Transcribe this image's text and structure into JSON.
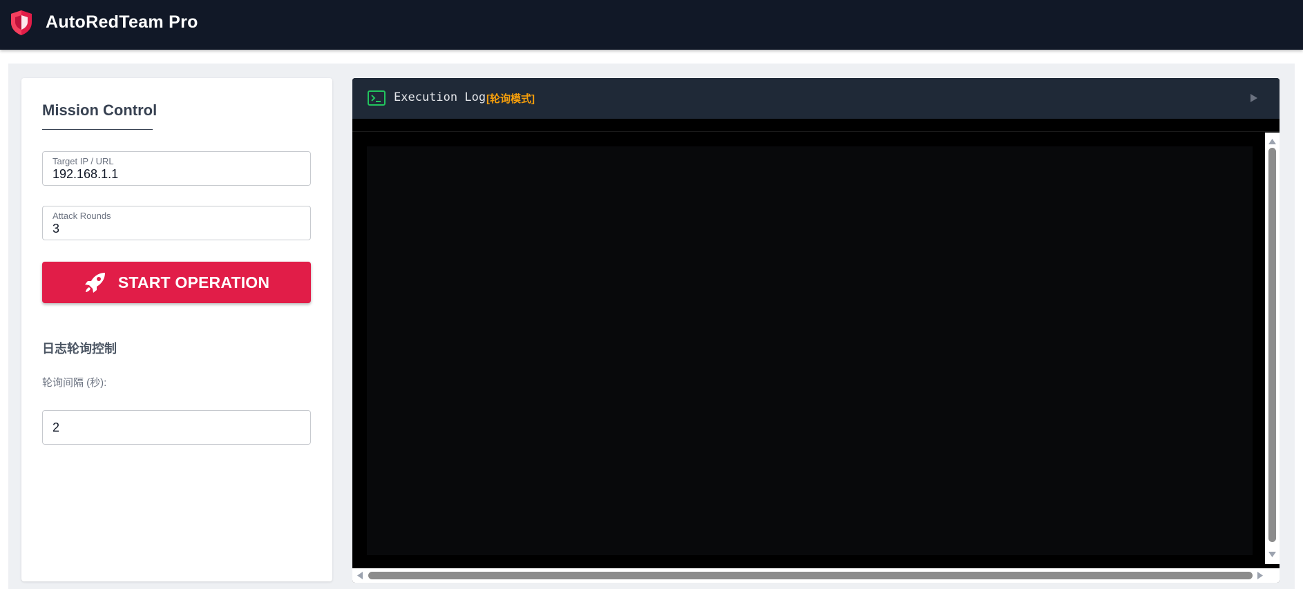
{
  "app": {
    "title": "AutoRedTeam Pro",
    "logo_icon": "shield-icon",
    "accent_color": "#e11d48"
  },
  "mission_control": {
    "title": "Mission Control",
    "target": {
      "label": "Target IP / URL",
      "value": "192.168.1.1"
    },
    "rounds": {
      "label": "Attack Rounds",
      "value": "3"
    },
    "start_button": {
      "label": "START OPERATION",
      "icon": "rocket-icon"
    }
  },
  "polling": {
    "heading": "日志轮询控制",
    "interval_label": "轮询间隔 (秒):",
    "interval_value": "2"
  },
  "log": {
    "title": "Execution Log",
    "mode": "[轮询模式]",
    "terminal_icon": "terminal-icon",
    "play_icon": "play-icon",
    "mode_color": "#f59e0b"
  }
}
